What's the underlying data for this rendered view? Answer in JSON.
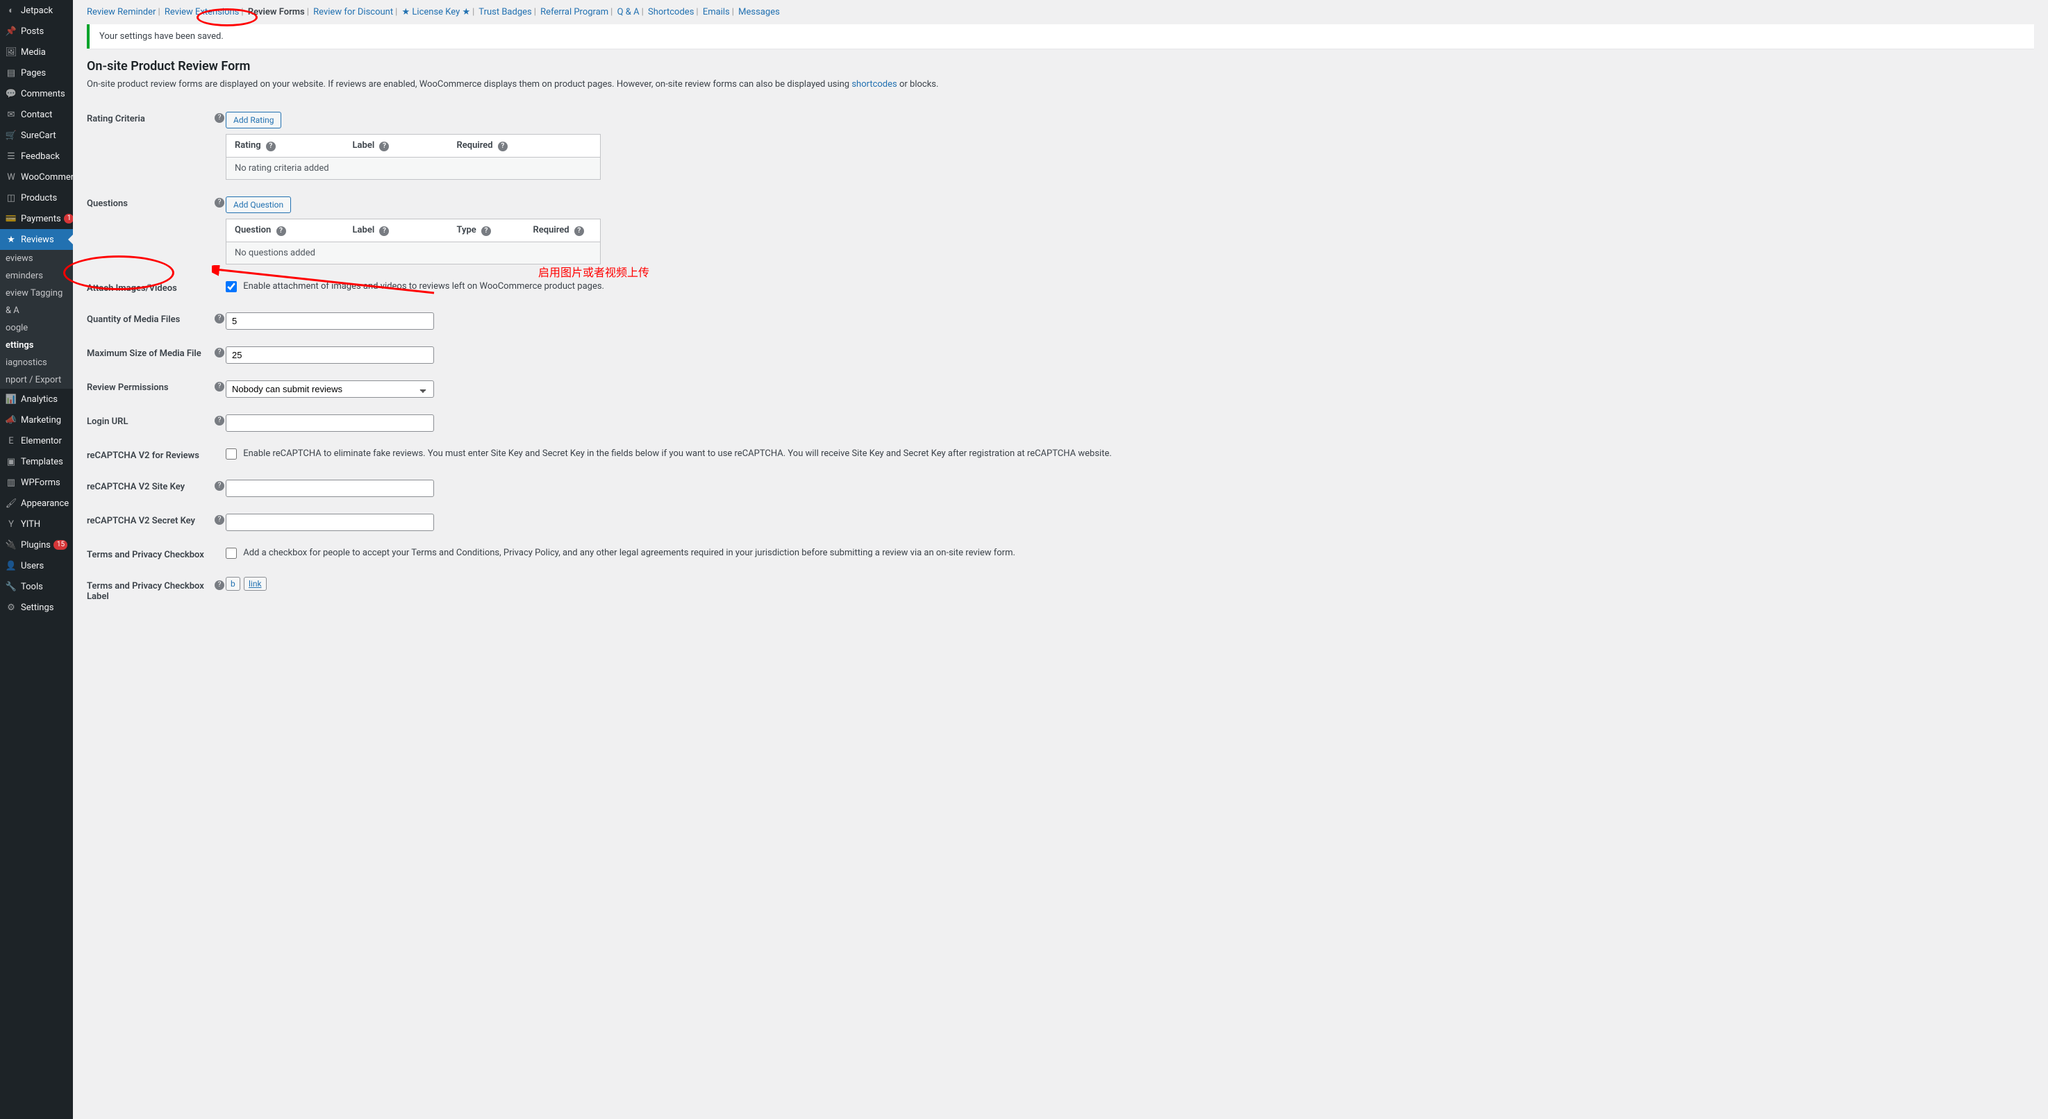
{
  "sidebar": {
    "items": [
      {
        "label": "Jetpack"
      },
      {
        "label": "Posts"
      },
      {
        "label": "Media"
      },
      {
        "label": "Pages"
      },
      {
        "label": "Comments"
      },
      {
        "label": "Contact"
      },
      {
        "label": "SureCart"
      },
      {
        "label": "Feedback"
      },
      {
        "label": "WooCommerce"
      },
      {
        "label": "Products"
      },
      {
        "label": "Payments",
        "badge": "1"
      },
      {
        "label": "Reviews",
        "current": true
      },
      {
        "label": "Analytics"
      },
      {
        "label": "Marketing"
      },
      {
        "label": "Elementor"
      },
      {
        "label": "Templates"
      },
      {
        "label": "WPForms"
      },
      {
        "label": "Appearance"
      },
      {
        "label": "YITH"
      },
      {
        "label": "Plugins",
        "badge": "15"
      },
      {
        "label": "Users"
      },
      {
        "label": "Tools"
      },
      {
        "label": "Settings"
      }
    ],
    "submenu": [
      {
        "label": "eviews"
      },
      {
        "label": "eminders"
      },
      {
        "label": "eview Tagging"
      },
      {
        "label": " & A"
      },
      {
        "label": "oogle"
      },
      {
        "label": "ettings",
        "current": true
      },
      {
        "label": "iagnostics"
      },
      {
        "label": "nport / Export"
      }
    ]
  },
  "tabs": [
    {
      "label": "Review Reminder"
    },
    {
      "label": "Review Extensions"
    },
    {
      "label": "Review Forms",
      "active": true
    },
    {
      "label": "Review for Discount"
    },
    {
      "label": "★ License Key ★"
    },
    {
      "label": "Trust Badges"
    },
    {
      "label": "Referral Program"
    },
    {
      "label": "Q & A"
    },
    {
      "label": "Shortcodes"
    },
    {
      "label": "Emails"
    },
    {
      "label": "Messages"
    }
  ],
  "notice": "Your settings have been saved.",
  "section": {
    "title": "On-site Product Review Form",
    "desc_a": "On-site product review forms are displayed on your website. If reviews are enabled, WooCommerce displays them on product pages. However, on-site review forms can also be displayed using ",
    "desc_link": "shortcodes",
    "desc_b": " or blocks."
  },
  "fields": {
    "rating_criteria": {
      "label": "Rating Criteria",
      "button": "Add Rating",
      "cols": {
        "c1": "Rating",
        "c2": "Label",
        "c3": "Required"
      },
      "empty": "No rating criteria added"
    },
    "questions": {
      "label": "Questions",
      "button": "Add Question",
      "cols": {
        "c1": "Question",
        "c2": "Label",
        "c3": "Type",
        "c4": "Required"
      },
      "empty": "No questions added"
    },
    "attach": {
      "label": "Attach Images/Videos",
      "checked": true,
      "desc": "Enable attachment of images and videos to reviews left on WooCommerce product pages."
    },
    "quantity": {
      "label": "Quantity of Media Files",
      "value": "5"
    },
    "maxsize": {
      "label": "Maximum Size of Media File",
      "value": "25"
    },
    "perms": {
      "label": "Review Permissions",
      "value": "Nobody can submit reviews"
    },
    "login": {
      "label": "Login URL",
      "value": ""
    },
    "recap": {
      "label": "reCAPTCHA V2 for Reviews",
      "checked": false,
      "desc": "Enable reCAPTCHA to eliminate fake reviews. You must enter Site Key and Secret Key in the fields below if you want to use reCAPTCHA. You will receive Site Key and Secret Key after registration at reCAPTCHA website."
    },
    "recap_site": {
      "label": "reCAPTCHA V2 Site Key",
      "value": ""
    },
    "recap_secret": {
      "label": "reCAPTCHA V2 Secret Key",
      "value": ""
    },
    "terms": {
      "label": "Terms and Privacy Checkbox",
      "checked": false,
      "desc": "Add a checkbox for people to accept your Terms and Conditions, Privacy Policy, and any other legal agreements required in your jurisdiction before submitting a review via an on-site review form."
    },
    "terms_label": {
      "label": "Terms and Privacy Checkbox Label",
      "b": "b",
      "link": "link"
    }
  },
  "annotation": {
    "text": "启用图片或者视频上传"
  }
}
